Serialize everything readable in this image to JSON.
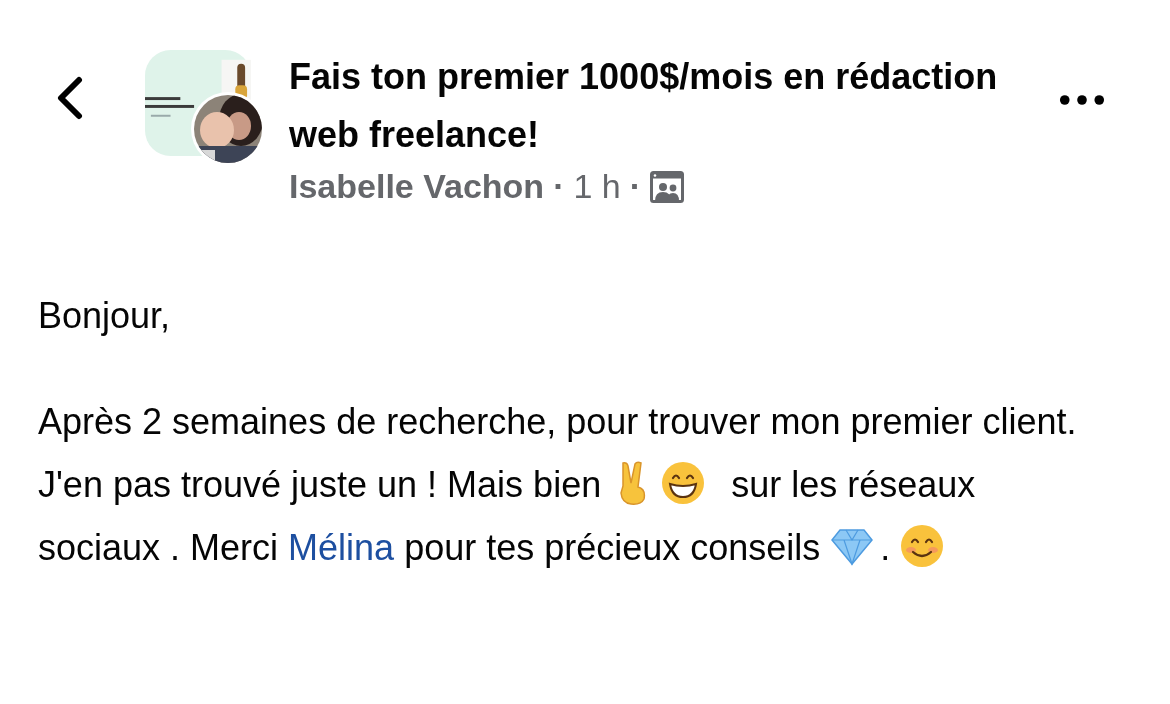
{
  "header": {
    "title": "Fais ton premier 1000$/mois en rédaction web freelance!",
    "meta": [
      {
        "kind": "author",
        "text": "Isabelle Vachon"
      },
      {
        "kind": "dot",
        "text": "·"
      },
      {
        "kind": "time",
        "text": "1 h"
      },
      {
        "kind": "dot",
        "text": "·"
      }
    ]
  },
  "post": {
    "greeting": "Bonjour,",
    "segments": [
      {
        "kind": "text",
        "text": "Après 2 semaines de recherche, pour trouver mon premier client. J'en pas trouvé juste un ! Mais bien "
      },
      {
        "kind": "victory-emoji"
      },
      {
        "kind": "grin-emoji"
      },
      {
        "kind": "text",
        "text": "  sur les réseaux sociaux . Merci "
      },
      {
        "kind": "mention",
        "text": "Mélina"
      },
      {
        "kind": "text",
        "text": " pour tes précieux conseils "
      },
      {
        "kind": "diamond-emoji"
      },
      {
        "kind": "text",
        "text": ". "
      },
      {
        "kind": "smile-emoji"
      }
    ]
  }
}
